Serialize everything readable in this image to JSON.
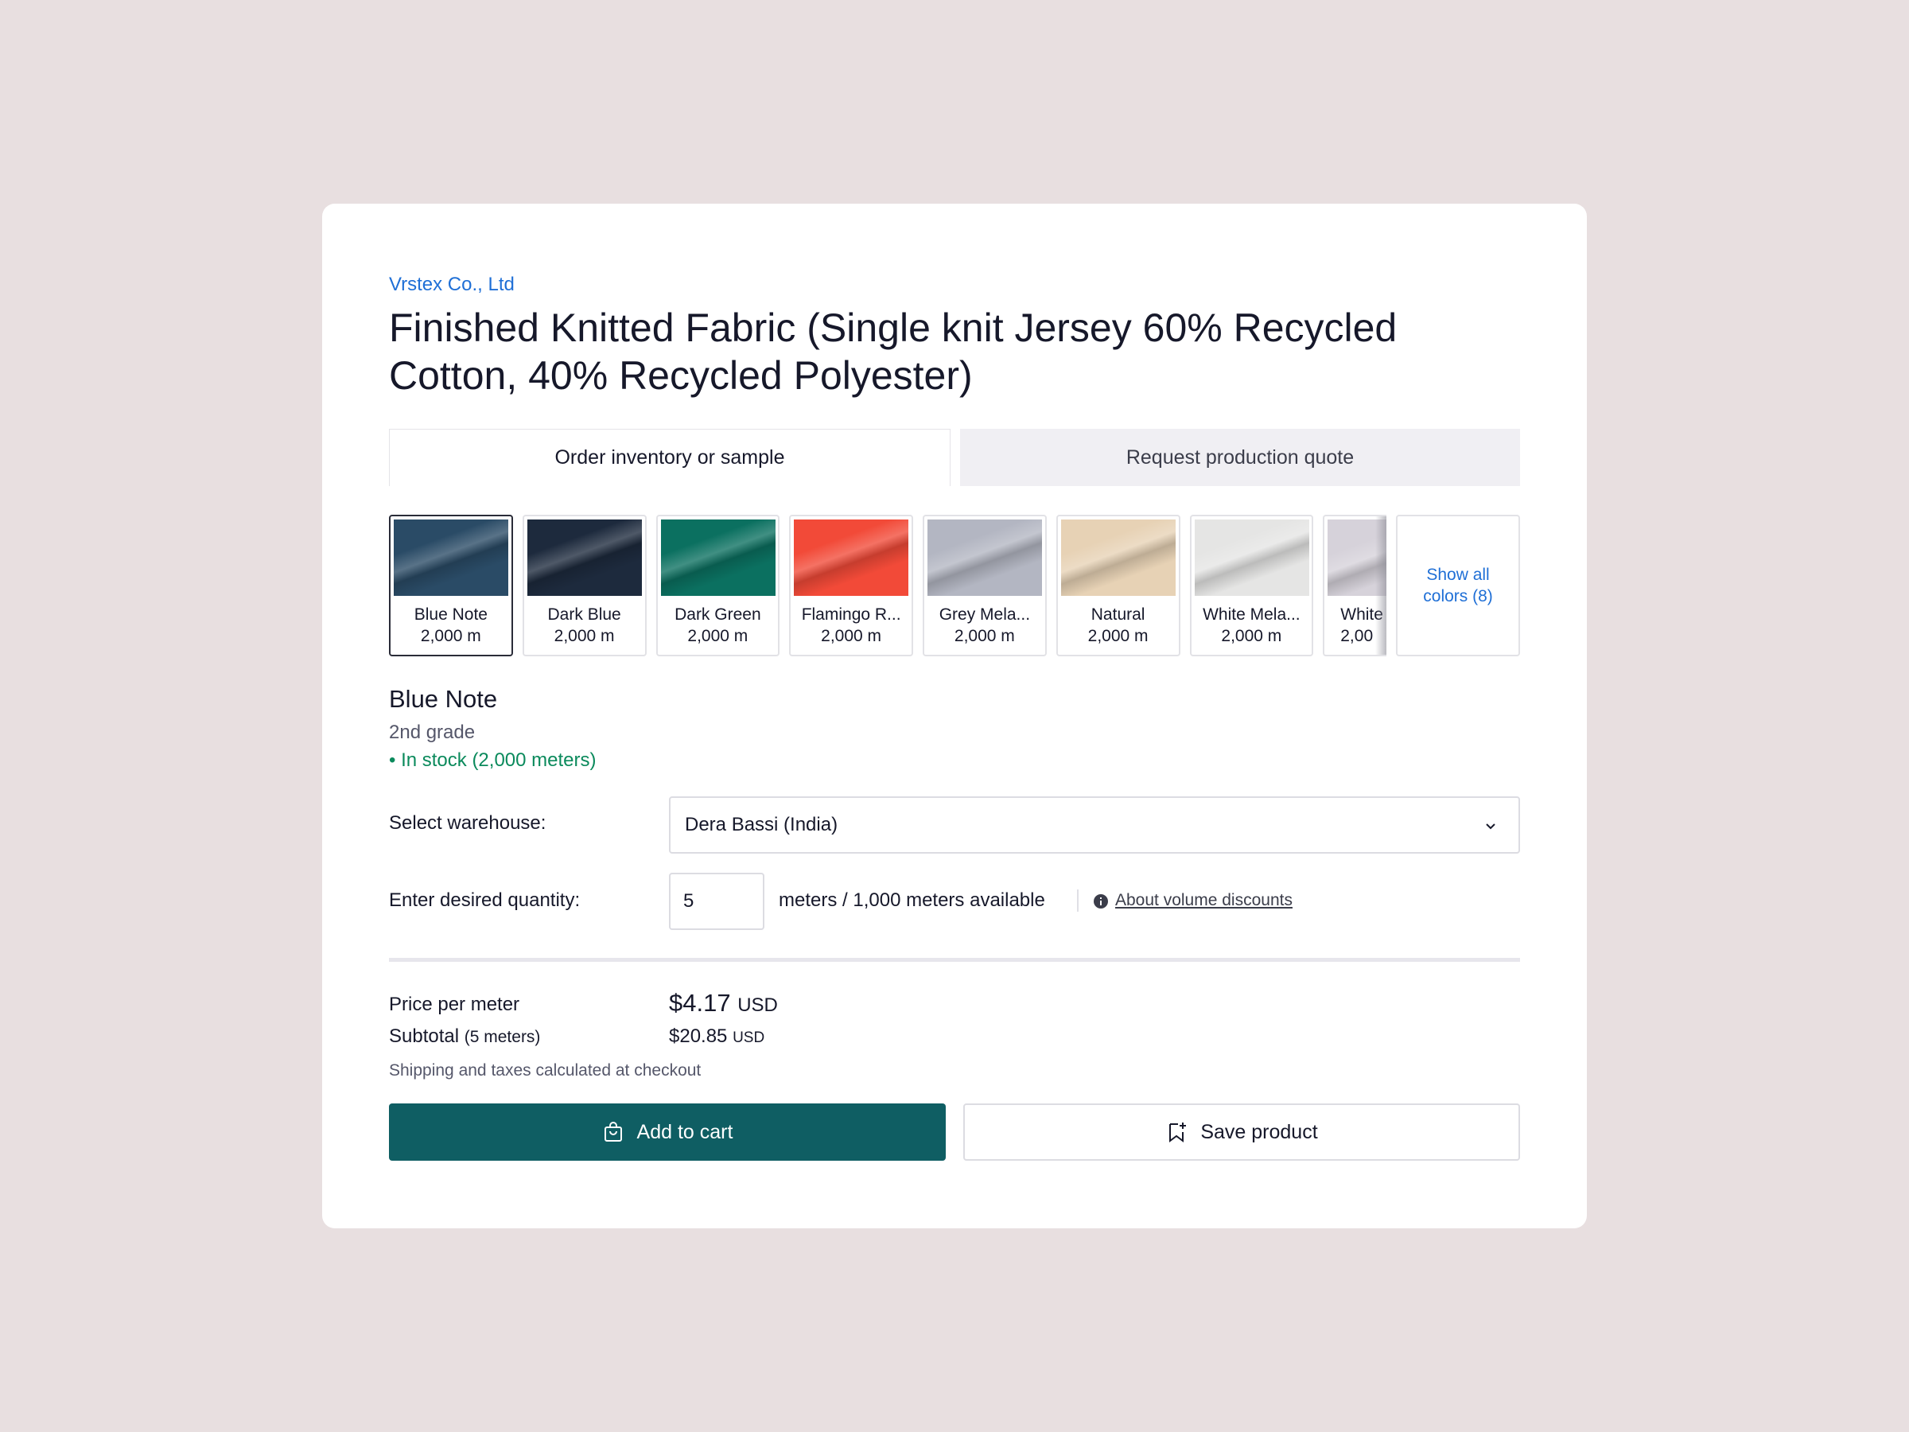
{
  "seller": "Vrstex Co., Ltd",
  "title": "Finished Knitted Fabric (Single knit Jersey 60% Recycled Cotton, 40% Recycled Polyester)",
  "tabs": [
    {
      "label": "Order inventory or sample",
      "active": true
    },
    {
      "label": "Request production quote",
      "active": false
    }
  ],
  "swatches": [
    {
      "name": "Blue Note",
      "qty": "2,000 m",
      "color": "#2a4b66",
      "selected": true
    },
    {
      "name": "Dark Blue",
      "qty": "2,000 m",
      "color": "#1d2a3d"
    },
    {
      "name": "Dark Green",
      "qty": "2,000 m",
      "color": "#0b7060"
    },
    {
      "name": "Flamingo R...",
      "qty": "2,000 m",
      "color": "#f24a38"
    },
    {
      "name": "Grey Mela...",
      "qty": "2,000 m",
      "color": "#b3b6c2"
    },
    {
      "name": "Natural",
      "qty": "2,000 m",
      "color": "#e7d2b5"
    },
    {
      "name": "White Mela...",
      "qty": "2,000 m",
      "color": "#e5e5e4"
    },
    {
      "name": "White",
      "qty": "2,00",
      "color": "#d6d2da"
    }
  ],
  "show_all": "Show all colors (8)",
  "selected": {
    "name": "Blue Note",
    "grade": "2nd grade",
    "stock": "• In stock (2,000 meters)"
  },
  "warehouse": {
    "label": "Select warehouse:",
    "value": "Dera Bassi (India)"
  },
  "quantity": {
    "label": "Enter desired quantity:",
    "value": "5",
    "available": "meters / 1,000 meters available",
    "volume_link": "About volume discounts"
  },
  "pricing": {
    "price_label": "Price per meter",
    "price": "$4.17",
    "currency": "USD",
    "subtotal_label": "Subtotal",
    "subtotal_qty": "(5 meters)",
    "subtotal": "$20.85",
    "shipping_note": "Shipping and taxes calculated at checkout"
  },
  "actions": {
    "add_to_cart": "Add to cart",
    "save_product": "Save product"
  },
  "colors": {
    "primary": "#0f5e63",
    "link": "#1f6fd6",
    "in_stock": "#0b8a5c",
    "background": "#e8dfe0"
  }
}
